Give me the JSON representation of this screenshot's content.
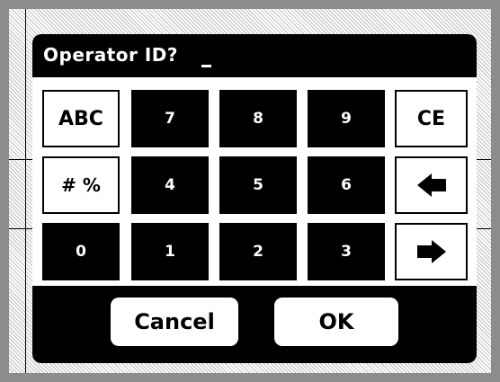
{
  "dialog": {
    "title": "Operator ID?",
    "entry_cursor": "_"
  },
  "keypad": {
    "mode_alpha": "ABC",
    "mode_symbols": "# %",
    "clear": "CE",
    "digits": {
      "d0": "0",
      "d1": "1",
      "d2": "2",
      "d3": "3",
      "d4": "4",
      "d5": "5",
      "d6": "6",
      "d7": "7",
      "d8": "8",
      "d9": "9"
    },
    "backspace_icon": "left-arrow-icon",
    "forward_icon": "right-arrow-icon"
  },
  "buttons": {
    "cancel": "Cancel",
    "ok": "OK"
  },
  "colors": {
    "dialog_bg": "#000000",
    "key_dark": "#000000",
    "key_light": "#ffffff"
  }
}
